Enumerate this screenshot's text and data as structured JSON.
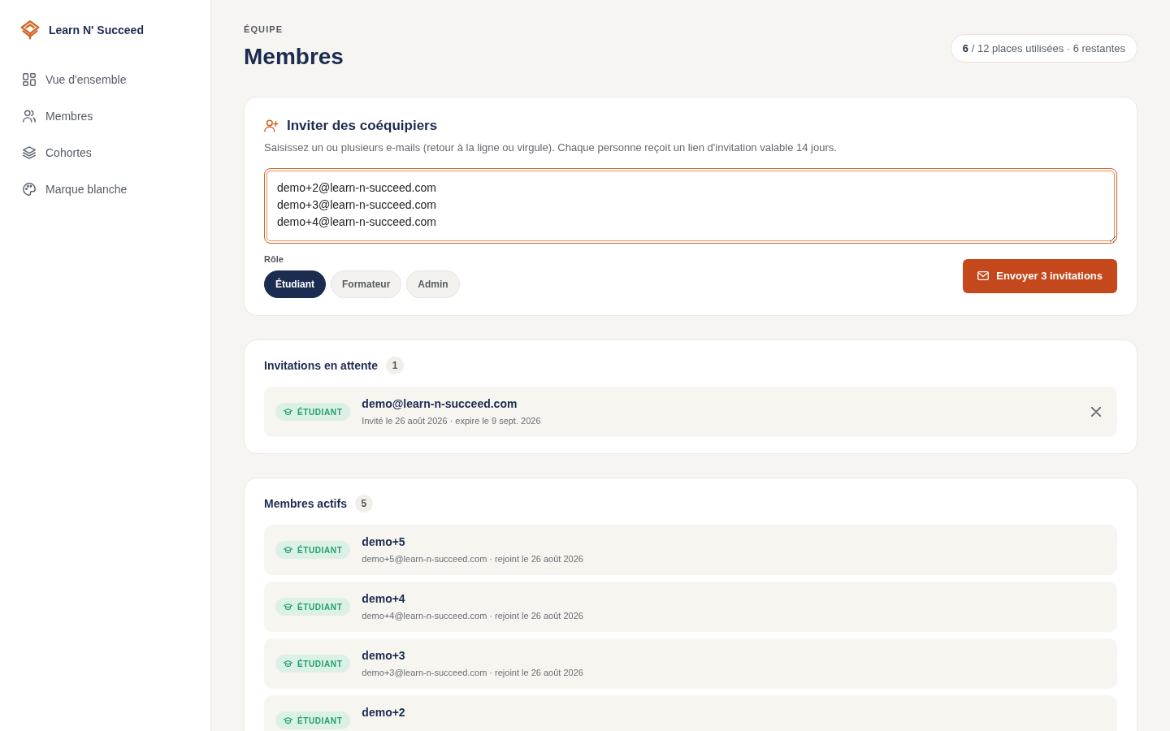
{
  "sidebar": {
    "brand": "Learn N' Succeed",
    "items": [
      {
        "label": "Vue d'ensemble",
        "selected": false
      },
      {
        "label": "Membres",
        "selected": false
      },
      {
        "label": "Cohortes",
        "selected": false
      },
      {
        "label": "Marque blanche",
        "selected": false
      }
    ]
  },
  "header": {
    "eyebrow": "ÉQUIPE",
    "title": "Membres",
    "seats": "**6** / 12 places utilisées · 6 restantes"
  },
  "invite": {
    "title": "Inviter des coéquipiers",
    "description": "Saisissez un ou plusieurs e-mails (retour à la ligne ou virgule). Chaque personne reçoit un lien d'invitation valable 14 jours.",
    "emails": "demo+2@learn-n-succeed.com\ndemo+3@learn-n-succeed.com\ndemo+4@learn-n-succeed.com",
    "focused": true,
    "role_label": "Rôle",
    "roles": [
      {
        "label": "Étudiant",
        "selected": true
      },
      {
        "label": "Formateur",
        "selected": false
      },
      {
        "label": "Admin",
        "selected": false
      }
    ],
    "submit": "Envoyer 3 invitations"
  },
  "pending": {
    "title": "Invitations en attente",
    "count": "1",
    "items": [
      {
        "role": "ÉTUDIANT",
        "email": "demo@learn-n-succeed.com",
        "meta": "Invité le 26 août 2026 · expire le 9 sept. 2026"
      }
    ]
  },
  "active": {
    "title": "Membres actifs",
    "count": "5",
    "items": [
      {
        "role": "ÉTUDIANT",
        "name": "demo+5",
        "meta": "demo+5@learn-n-succeed.com · rejoint le 26 août 2026"
      },
      {
        "role": "ÉTUDIANT",
        "name": "demo+4",
        "meta": "demo+4@learn-n-succeed.com · rejoint le 26 août 2026"
      },
      {
        "role": "ÉTUDIANT",
        "name": "demo+3",
        "meta": "demo+3@learn-n-succeed.com · rejoint le 26 août 2026"
      },
      {
        "role": "ÉTUDIANT",
        "name": "demo+2"
      }
    ]
  }
}
